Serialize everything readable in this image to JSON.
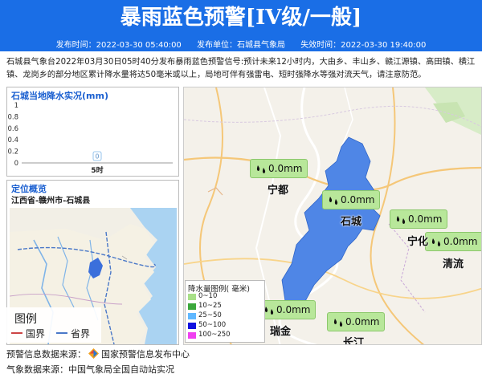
{
  "header": {
    "title": "暴雨蓝色预警[IV级/一般]",
    "publish_time": "发布时间：2022-03-30 05:40:00",
    "publisher": "发布单位：石城县气象局",
    "expire_time": "失效时间：2022-03-30 19:40:00"
  },
  "description": "石城县气象台2022年03月30日05时40分发布暴雨蓝色预警信号:预计未来12小时内，大由乡、丰山乡、赣江源镇、高田镇、横江镇、龙岗乡的部分地区累计降水量将达50毫米或以上，局地可伴有强雷电、短时强降水等强对流天气，请注意防范。",
  "rain_panel": {
    "title": "石城当地降水实况(mm)",
    "chart_data": {
      "type": "bar",
      "categories": [
        "5时"
      ],
      "values": [
        0
      ],
      "data_labels": [
        "0"
      ],
      "yticks": [
        "1",
        "0.8",
        "0.6",
        "0.4",
        "0.2",
        "0"
      ],
      "ylim": [
        0,
        1
      ]
    }
  },
  "location_panel": {
    "title": "定位概览",
    "location": "江西省-赣州市-石城县",
    "legend_title": "图例",
    "legend_items": [
      {
        "label": "国界",
        "color": "#c44"
      },
      {
        "label": "省界",
        "color": "#4a78c8"
      }
    ]
  },
  "main_map": {
    "colors": {
      "warning_area": "#4f86e6",
      "badge": "#b8e79a"
    },
    "badges": [
      {
        "label": "0.0mm"
      },
      {
        "label": "0.0mm"
      },
      {
        "label": "0.0mm"
      },
      {
        "label": "0.0mm"
      },
      {
        "label": "0.0mm"
      },
      {
        "label": "0.0mm"
      }
    ],
    "places": [
      "宁都",
      "石城",
      "宁化",
      "清流",
      "瑞金",
      "长汀"
    ],
    "legend": {
      "title": "降水量图例( 毫米)",
      "items": [
        {
          "label": "0~10",
          "color": "#a8e088"
        },
        {
          "label": "10~25",
          "color": "#3ca83c"
        },
        {
          "label": "25~50",
          "color": "#60b8ff"
        },
        {
          "label": "50~100",
          "color": "#1010e0"
        },
        {
          "label": "100~250",
          "color": "#f040f0"
        }
      ]
    }
  },
  "footer": {
    "source1_label": "预警信息数据来源：",
    "source1_value": "国家预警信息发布中心",
    "source2": "气象数据来源：中国气象局全国自动站实况"
  }
}
